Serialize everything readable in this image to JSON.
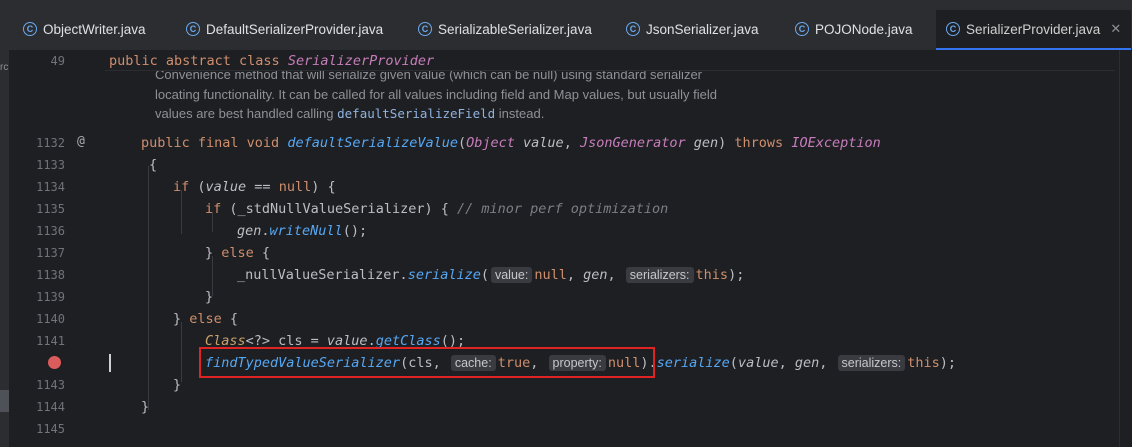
{
  "tabs": [
    {
      "label": "ObjectWriter.java",
      "icon": "class-icon"
    },
    {
      "label": "DefaultSerializerProvider.java",
      "icon": "class-icon"
    },
    {
      "label": "SerializableSerializer.java",
      "icon": "class-icon"
    },
    {
      "label": "JsonSerializer.java",
      "icon": "class-icon"
    },
    {
      "label": "POJONode.java",
      "icon": "class-icon"
    },
    {
      "label": "SerializerProvider.java",
      "icon": "class-icon",
      "active": true
    }
  ],
  "left_fragment": "rc",
  "sticky": {
    "line": "49",
    "kw1": "public abstract class ",
    "name": "SerializerProvider"
  },
  "doc": {
    "line1": "Convenience method that will serialize given value (which can be null) using standard serializer",
    "line2": "locating functionality. It can be called for all values including field and Map values, but usually field",
    "line3a": "values are best handled calling ",
    "line3code": "defaultSerializeField",
    "line3b": " instead."
  },
  "lines": {
    "l1132": "1132",
    "l1133": "1133",
    "l1134": "1134",
    "l1135": "1135",
    "l1136": "1136",
    "l1137": "1137",
    "l1138": "1138",
    "l1139": "1139",
    "l1140": "1140",
    "l1141": "1141",
    "l1143": "1143",
    "l1144": "1144",
    "l1145": "1145"
  },
  "code": {
    "c1132_kw": "public final void ",
    "c1132_m": "defaultSerializeValue",
    "c1132_o": "(",
    "c1132_t1": "Object",
    "c1132_p1": " value",
    "c1132_c": ", ",
    "c1132_t2": "JsonGenerator",
    "c1132_p2": " gen",
    "c1132_cl": ") ",
    "c1132_th": "throws ",
    "c1132_ex": "IOException",
    "c1133": "{",
    "c1134_if": "if ",
    "c1134_a": "(",
    "c1134_v": "value",
    "c1134_b": " == ",
    "c1134_n": "null",
    "c1134_c": ") {",
    "c1135_if": "if ",
    "c1135_a": "(_stdNullValueSerializer) { ",
    "c1135_cm": "// minor perf optimization",
    "c1136_g": "gen",
    "c1136_d": ".",
    "c1136_m": "writeNull",
    "c1136_e": "();",
    "c1137_a": "} ",
    "c1137_else": "else ",
    "c1137_b": "{",
    "c1138_a": "_nullValueSerializer.",
    "c1138_m": "serialize",
    "c1138_o": "(",
    "c1138_h1": "value:",
    "c1138_n": "null",
    "c1138_c": ", ",
    "c1138_g": "gen",
    "c1138_c2": ",",
    "c1138_h2": "serializers:",
    "c1138_this": "this",
    "c1138_e": ");",
    "c1139": "}",
    "c1140_a": "} ",
    "c1140_else": "else ",
    "c1140_b": "{",
    "c1141_t": "Class",
    "c1141_a": "<?> cls = ",
    "c1141_v": "value",
    "c1141_d": ".",
    "c1141_m": "getClass",
    "c1141_e": "();",
    "c1142_m": "findTypedValueSerializer",
    "c1142_a": "(cls, ",
    "c1142_h1": "cache:",
    "c1142_t": "true",
    "c1142_c": ",",
    "c1142_h2": "property:",
    "c1142_n": "null",
    "c1142_cl": ")",
    "c1142_d": ".",
    "c1142_s": "serialize",
    "c1142_o": "(",
    "c1142_v": "value",
    "c1142_c2": ", ",
    "c1142_g": "gen",
    "c1142_c3": ",",
    "c1142_h3": "serializers:",
    "c1142_this": "this",
    "c1142_e": ");",
    "c1143": "}",
    "c1144": "}"
  },
  "colors": {
    "keyword": "#cf8e6d",
    "method": "#56a8f5",
    "type": "#c77dbb",
    "comment": "#7a7e85",
    "highlight_box": "#e02424",
    "breakpoint": "#db5c5c"
  }
}
